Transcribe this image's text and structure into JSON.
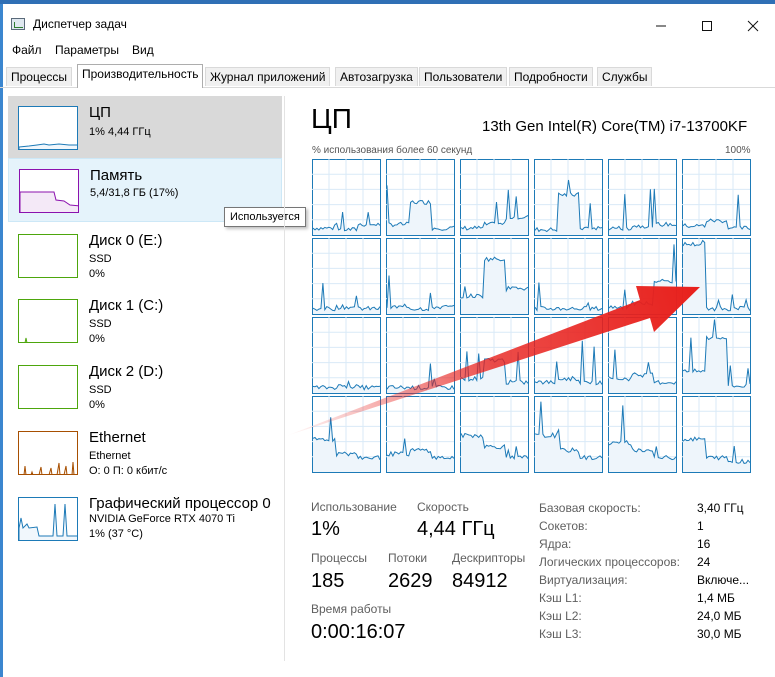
{
  "window": {
    "title": "Диспетчер задач"
  },
  "menu": [
    "Файл",
    "Параметры",
    "Вид"
  ],
  "tabs": [
    "Процессы",
    "Производительность",
    "Журнал приложений",
    "Автозагрузка",
    "Пользователи",
    "Подробности",
    "Службы"
  ],
  "active_tab": "Производительность",
  "resources": [
    {
      "title": "ЦП",
      "sub1": "1% 4,44 ГГц",
      "sub2": "",
      "sub3": "",
      "color": "#1d7ab7"
    },
    {
      "title": "Память",
      "sub1": "5,4/31,8 ГБ (17%)",
      "sub2": "",
      "sub3": "",
      "color": "#8b12ae"
    },
    {
      "title": "Диск 0 (E:)",
      "sub1": "SSD",
      "sub2": "0%",
      "sub3": "",
      "color": "#4da60c"
    },
    {
      "title": "Диск 1 (C:)",
      "sub1": "SSD",
      "sub2": "0%",
      "sub3": "",
      "color": "#4da60c"
    },
    {
      "title": "Диск 2 (D:)",
      "sub1": "SSD",
      "sub2": "0%",
      "sub3": "",
      "color": "#4da60c"
    },
    {
      "title": "Ethernet",
      "sub1": "Ethernet",
      "sub2": "О: 0 П: 0 кбит/с",
      "sub3": "",
      "color": "#a74f01"
    },
    {
      "title": "Графический процессор 0",
      "sub1": "NVIDIA GeForce RTX 4070 Ti",
      "sub2": "1% (37 °C)",
      "sub3": "",
      "color": "#1d7ab7"
    }
  ],
  "tooltip": "Используется",
  "detail": {
    "title": "ЦП",
    "model": "13th Gen Intel(R) Core(TM) i7-13700KF",
    "graph_caption_left": "% использования более 60 секунд",
    "graph_caption_right": "100%"
  },
  "stats": {
    "usage_label": "Использование",
    "usage_value": "1%",
    "speed_label": "Скорость",
    "speed_value": "4,44 ГГц",
    "processes_label": "Процессы",
    "processes_value": "185",
    "threads_label": "Потоки",
    "threads_value": "2629",
    "handles_label": "Дескрипторы",
    "handles_value": "84912",
    "uptime_label": "Время работы",
    "uptime_value": "0:00:16:07"
  },
  "info": [
    {
      "label": "Базовая скорость:",
      "value": "3,40 ГГц"
    },
    {
      "label": "Сокетов:",
      "value": "1"
    },
    {
      "label": "Ядра:",
      "value": "16"
    },
    {
      "label": "Логических процессоров:",
      "value": "24"
    },
    {
      "label": "Виртуализация:",
      "value": "Включе..."
    },
    {
      "label": "Кэш L1:",
      "value": "1,4 МБ"
    },
    {
      "label": "Кэш L2:",
      "value": "24,0 МБ"
    },
    {
      "label": "Кэш L3:",
      "value": "30,0 МБ"
    }
  ],
  "colors": {
    "cpu": "#1d7ab7",
    "memory": "#8b12ae",
    "disk": "#4da60c",
    "ethernet": "#a74f01",
    "arrow": "#e8201c"
  }
}
